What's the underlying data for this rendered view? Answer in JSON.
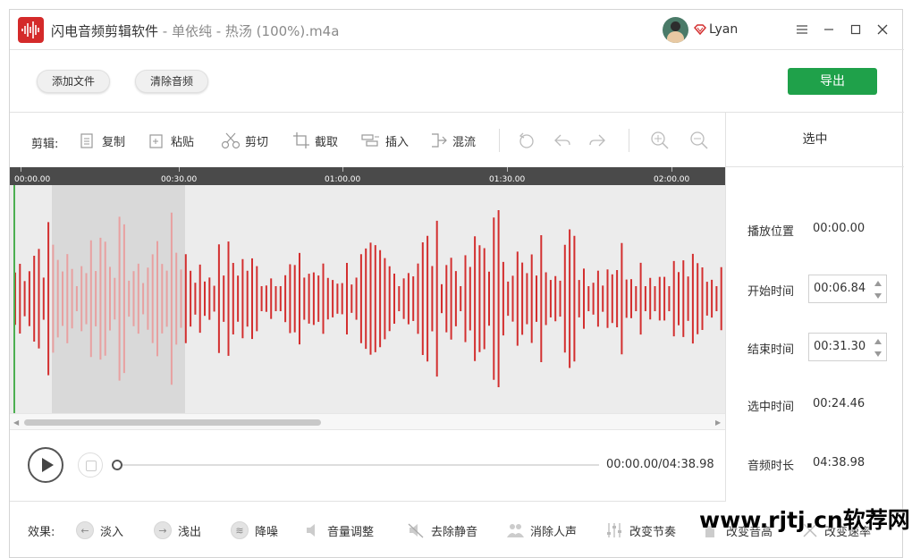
{
  "titlebar": {
    "app_name": "闪电音频剪辑软件",
    "separator": " - ",
    "file_name": "单依纯 - 热汤 (100%).m4a",
    "user_name": "Lyan"
  },
  "actions": {
    "add_file": "添加文件",
    "clear_audio": "清除音频",
    "export": "导出"
  },
  "toolbar": {
    "label": "剪辑:",
    "copy": "复制",
    "paste": "粘贴",
    "cut": "剪切",
    "crop": "截取",
    "insert": "插入",
    "mix": "混流"
  },
  "timeline": {
    "ticks": [
      "00:00.00",
      "00:30.00",
      "01:00.00",
      "01:30.00",
      "02:00.00"
    ]
  },
  "selection_panel": {
    "title": "选中",
    "play_position_label": "播放位置",
    "play_position": "00:00.00",
    "start_label": "开始时间",
    "start_time": "00:06.84",
    "end_label": "结束时间",
    "end_time": "00:31.30",
    "selected_label": "选中时间",
    "selected_time": "00:24.46",
    "duration_label": "音频时长",
    "duration": "04:38.98"
  },
  "player": {
    "time_readout": "00:00.00/04:38.98",
    "progress_fraction": 0.0
  },
  "effects": {
    "label": "效果:",
    "fade_in": "淡入",
    "fade_out": "浅出",
    "denoise": "降噪",
    "volume": "音量调整",
    "remove_silence": "去除静音",
    "remove_vocals": "消除人声",
    "change_tempo": "改变节奏",
    "change_pitch": "改变音高",
    "change_speed": "改变速率"
  },
  "watermark": "www.rjtj.cn软荐网",
  "colors": {
    "wave": "#d32f2f",
    "wave_selected": "#e8a0a0",
    "export_button": "#1fa14a",
    "playhead": "#4caf50"
  }
}
